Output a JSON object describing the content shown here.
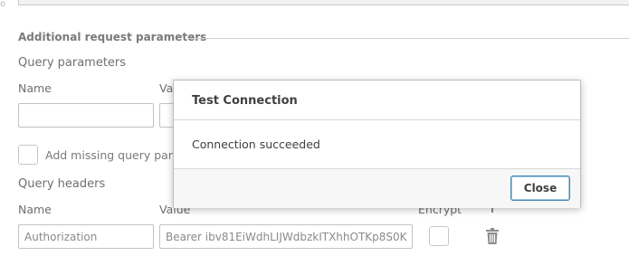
{
  "section": {
    "title": "Additional request parameters"
  },
  "query_parameters": {
    "heading": "Query parameters",
    "name_label": "Name",
    "value_label_partial": "Val",
    "name_value": "",
    "value_value": ""
  },
  "add_missing": {
    "label": "Add missing query param"
  },
  "query_headers": {
    "heading": "Query headers",
    "name_label": "Name",
    "value_label": "Value",
    "encrypt_label": "Encrypt",
    "rows": [
      {
        "name": "Authorization",
        "value": "Bearer ibv81EiWdhLIJWdbzkITXhhOTKp8S0K",
        "encrypt": false
      }
    ]
  },
  "dialog": {
    "title": "Test Connection",
    "message": "Connection succeeded",
    "close_label": "Close"
  },
  "icons": {
    "delete": "trash-icon"
  },
  "colors": {
    "accent_border": "#3f8ab4"
  }
}
